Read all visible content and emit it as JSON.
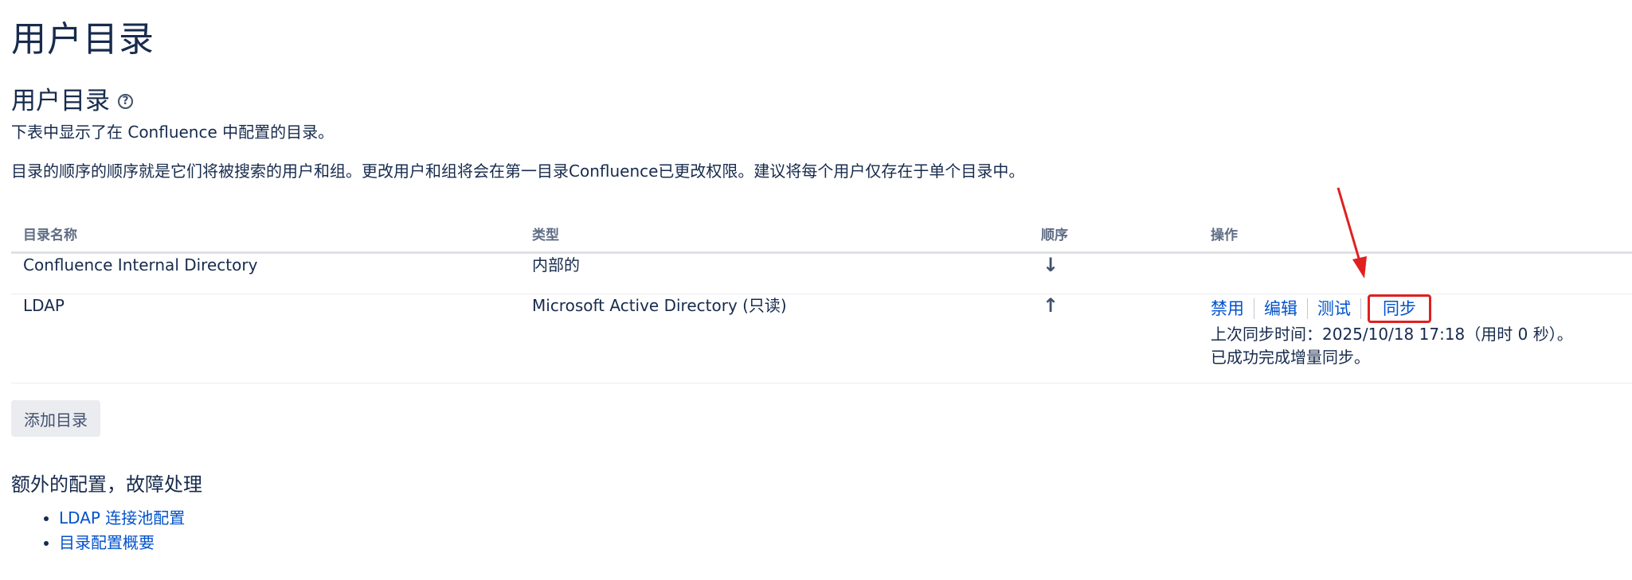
{
  "page": {
    "title": "用户目录"
  },
  "section": {
    "title": "用户目录",
    "help_icon": "help-circle-icon",
    "desc1": "下表中显示了在 Confluence 中配置的目录。",
    "desc2": "目录的顺序的顺序就是它们将被搜索的用户和组。更改用户和组将会在第一目录Confluence已更改权限。建议将每个用户仅存在于单个目录中。"
  },
  "table": {
    "headers": [
      "目录名称",
      "类型",
      "顺序",
      "操作"
    ],
    "rows": [
      {
        "name": "Confluence Internal Directory",
        "type": "内部的",
        "order_icon": "arrow-down-icon",
        "order_glyph": "↓"
      },
      {
        "name": "LDAP",
        "type": "Microsoft Active Directory (只读)",
        "order_icon": "arrow-up-icon",
        "order_glyph": "↑",
        "ops": {
          "disable": "禁用",
          "edit": "编辑",
          "test": "测试",
          "sync": "同步"
        },
        "sync_info_1": "上次同步时间：2025/10/18 17:18（用时 0 秒）。",
        "sync_info_2": "已成功完成增量同步。"
      }
    ]
  },
  "buttons": {
    "add_directory": "添加目录"
  },
  "extra": {
    "title": "额外的配置，故障处理",
    "links": [
      "LDAP 连接池配置",
      "目录配置概要"
    ]
  },
  "colors": {
    "link": "#0052cc",
    "annotation": "#e02020",
    "text": "#172b4d"
  }
}
